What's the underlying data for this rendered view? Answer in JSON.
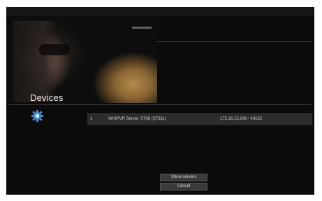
{
  "page": {
    "title": "Devices"
  },
  "devices": [
    {
      "index": "1",
      "name": "WHIPVR Server: 5708 (ST811)",
      "address": "172.16.15.243 : 49152",
      "icon": "gear-icon"
    }
  ],
  "buttons": {
    "show_servers": "Show servers",
    "cancel": "Cancel"
  },
  "colors": {
    "background": "#0b0b0b",
    "row_background": "#2c2c2c",
    "icon_accent": "#3f8fd2",
    "button_background": "#3a3a3a",
    "text": "#d0d0d0"
  }
}
